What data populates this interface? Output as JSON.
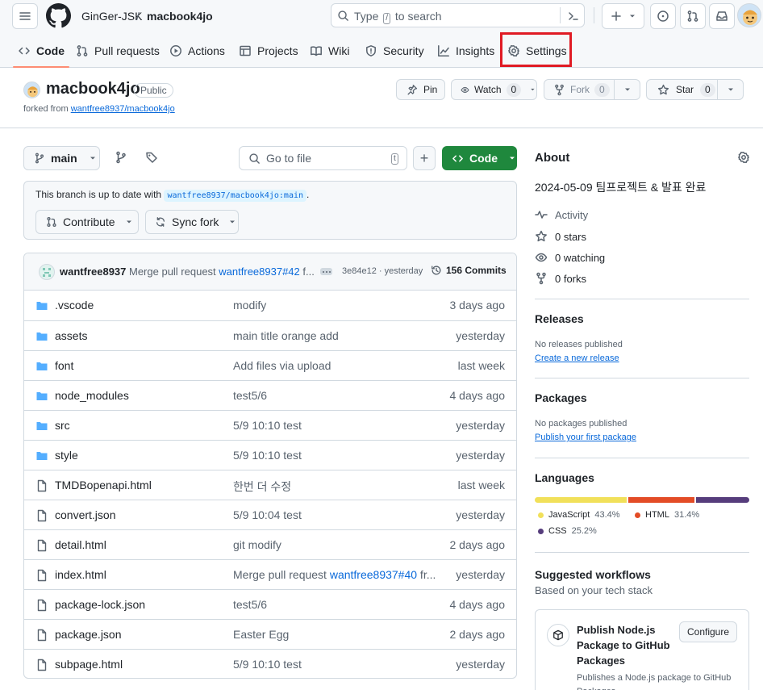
{
  "header": {
    "owner": "GinGer-JSK",
    "separator": "/",
    "repo": "macbook4jo",
    "search_prefix": "Type",
    "search_key": "/",
    "search_suffix": "to search"
  },
  "nav": {
    "tabs": [
      {
        "label": "Code",
        "icon": "code-icon"
      },
      {
        "label": "Pull requests",
        "icon": "git-pull-request-icon"
      },
      {
        "label": "Actions",
        "icon": "play-icon"
      },
      {
        "label": "Projects",
        "icon": "table-icon"
      },
      {
        "label": "Wiki",
        "icon": "book-icon"
      },
      {
        "label": "Security",
        "icon": "shield-icon"
      },
      {
        "label": "Insights",
        "icon": "graph-icon"
      },
      {
        "label": "Settings",
        "icon": "gear-icon"
      }
    ],
    "selected": "Code",
    "highlighted": "Settings",
    "highlight_color": "#e01b24"
  },
  "repo": {
    "name": "macbook4jo",
    "visibility": "Public",
    "forked_from_label": "forked from",
    "forked_from": "wantfree8937/macbook4jo",
    "pin_label": "Pin",
    "watch_label": "Watch",
    "watch_count": "0",
    "fork_label": "Fork",
    "fork_count": "0",
    "star_label": "Star",
    "star_count": "0"
  },
  "toolbar": {
    "branch": "main",
    "goto_placeholder": "Go to file",
    "goto_key": "t",
    "add_label": "+",
    "code_label": "Code",
    "code_color": "#1f883d"
  },
  "branch_status": {
    "text": "This branch is up to date with",
    "ref": "wantfree8937/macbook4jo:main",
    "end": ".",
    "contribute_label": "Contribute",
    "sync_label": "Sync fork"
  },
  "commit": {
    "author": "wantfree8937",
    "message": "Merge pull request",
    "pr": "wantfree8937#42",
    "message_tail": "f...",
    "hash": "3e84e12 · yesterday",
    "count": "156 Commits"
  },
  "files": [
    {
      "type": "folder",
      "name": ".vscode",
      "message": "modify",
      "date": "3 days ago"
    },
    {
      "type": "folder",
      "name": "assets",
      "message": "main title orange add",
      "date": "yesterday"
    },
    {
      "type": "folder",
      "name": "font",
      "message": "Add files via upload",
      "date": "last week"
    },
    {
      "type": "folder",
      "name": "node_modules",
      "message": "test5/6",
      "date": "4 days ago"
    },
    {
      "type": "folder",
      "name": "src",
      "message": "5/9 10:10 test",
      "date": "yesterday"
    },
    {
      "type": "folder",
      "name": "style",
      "message": "5/9 10:10 test",
      "date": "yesterday"
    },
    {
      "type": "file",
      "name": "TMDBopenapi.html",
      "message": "한번 더 수정",
      "date": "last week"
    },
    {
      "type": "file",
      "name": "convert.json",
      "message": "5/9 10:04 test",
      "date": "yesterday"
    },
    {
      "type": "file",
      "name": "detail.html",
      "message": "git modify",
      "date": "2 days ago"
    },
    {
      "type": "file",
      "name": "index.html",
      "message": "Merge pull request",
      "message_link": "wantfree8937#40",
      "message_tail": "fr...",
      "date": "yesterday"
    },
    {
      "type": "file",
      "name": "package-lock.json",
      "message": "test5/6",
      "date": "4 days ago"
    },
    {
      "type": "file",
      "name": "package.json",
      "message": "Easter Egg",
      "date": "2 days ago"
    },
    {
      "type": "file",
      "name": "subpage.html",
      "message": "5/9 10:10 test",
      "date": "yesterday"
    }
  ],
  "about": {
    "title": "About",
    "description": "2024-05-09 팀프로젝트 & 발표 완료",
    "activity": "Activity",
    "stars": "0 stars",
    "watching": "0 watching",
    "forks": "0 forks"
  },
  "releases": {
    "title": "Releases",
    "empty": "No releases published",
    "create": "Create a new release"
  },
  "packages": {
    "title": "Packages",
    "empty": "No packages published",
    "publish": "Publish your first package"
  },
  "languages": {
    "title": "Languages",
    "items": [
      {
        "name": "JavaScript",
        "percent": "43.4%",
        "value": 43.4,
        "color": "#f1e05a"
      },
      {
        "name": "HTML",
        "percent": "31.4%",
        "value": 31.4,
        "color": "#e34c26"
      },
      {
        "name": "CSS",
        "percent": "25.2%",
        "value": 25.2,
        "color": "#563d7c"
      }
    ]
  },
  "workflows": {
    "title": "Suggested workflows",
    "subtitle": "Based on your tech stack",
    "card_title": "Publish Node.js Package to GitHub Packages",
    "card_desc": "Publishes a Node.js package to GitHub Packages.",
    "configure_label": "Configure"
  }
}
